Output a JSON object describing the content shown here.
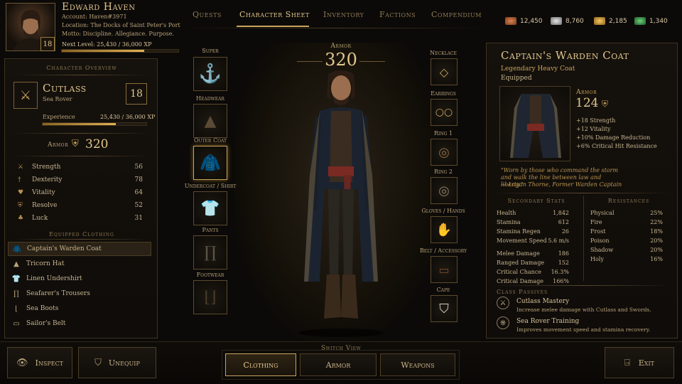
{
  "player": {
    "name": "Edward Haven",
    "account": "Account: Haven#3971",
    "location": "Location: The Docks of Saint Peter's Port",
    "motto": "Motto: Discipline. Allegiance. Purpose.",
    "level": "18",
    "next_level": "Next Level: 25,430 / 36,000 XP",
    "xp_fraction": 0.706
  },
  "tabs": [
    {
      "label": "Quests",
      "active": false
    },
    {
      "label": "Character Sheet",
      "active": true
    },
    {
      "label": "Inventory",
      "active": false
    },
    {
      "label": "Factions",
      "active": false
    },
    {
      "label": "Compendium",
      "active": false
    }
  ],
  "currencies": [
    {
      "icon": "copper-coins-icon",
      "value": "12,450",
      "color": "#b5603a"
    },
    {
      "icon": "silver-coins-icon",
      "value": "8,760",
      "color": "#b9b9b9"
    },
    {
      "icon": "gold-coins-icon",
      "value": "2,185",
      "color": "#d9a13a"
    },
    {
      "icon": "gem-icon",
      "value": "1,340",
      "color": "#3f9a4a"
    }
  ],
  "overview": {
    "title": "Character Overview",
    "class_name": "Cutlass",
    "subclass": "Sea Rover",
    "level": "18",
    "experience_label": "Experience",
    "experience_value": "25,430 / 36,000 XP",
    "armor_label": "Armor",
    "armor_value": "320",
    "stats": [
      {
        "name": "Strength",
        "value": "56",
        "icon": "sword-icon"
      },
      {
        "name": "Dexterity",
        "value": "78",
        "icon": "dagger-icon"
      },
      {
        "name": "Vitality",
        "value": "64",
        "icon": "heart-icon"
      },
      {
        "name": "Resolve",
        "value": "52",
        "icon": "shield-icon"
      },
      {
        "name": "Luck",
        "value": "31",
        "icon": "clover-icon"
      }
    ],
    "equipped_title": "Equipped Clothing",
    "equipped": [
      {
        "name": "Captain's Warden Coat",
        "icon": "coat-icon",
        "selected": true
      },
      {
        "name": "Tricorn Hat",
        "icon": "hat-icon",
        "selected": false
      },
      {
        "name": "Linen Undershirt",
        "icon": "shirt-icon",
        "selected": false
      },
      {
        "name": "Seafarer's Trousers",
        "icon": "trousers-icon",
        "selected": false
      },
      {
        "name": "Sea Boots",
        "icon": "boots-icon",
        "selected": false
      },
      {
        "name": "Sailor's Belt",
        "icon": "belt-icon",
        "selected": false
      }
    ]
  },
  "center": {
    "armor_label": "Armor",
    "armor_value": "320",
    "left_slots": [
      {
        "label": "Super",
        "icon": "anchor-icon",
        "selected": false
      },
      {
        "label": "Headwear",
        "icon": "tricorn-hat-icon",
        "selected": false
      },
      {
        "label": "Outer Coat",
        "icon": "coat-icon",
        "selected": true
      },
      {
        "label": "Undercoat / Shirt",
        "icon": "shirt-icon",
        "selected": false
      },
      {
        "label": "Pants",
        "icon": "trousers-icon",
        "selected": false
      },
      {
        "label": "Footwear",
        "icon": "boots-icon",
        "selected": false
      }
    ],
    "right_slots": [
      {
        "label": "Necklace",
        "icon": "necklace-icon"
      },
      {
        "label": "Earrings",
        "icon": "earrings-icon"
      },
      {
        "label": "Ring 1",
        "icon": "ring-icon"
      },
      {
        "label": "Ring 2",
        "icon": "ring-icon"
      },
      {
        "label": "Gloves / Hands",
        "icon": "glove-icon"
      },
      {
        "label": "Belt / Accessory",
        "icon": "belt-icon"
      },
      {
        "label": "Cape",
        "icon": "cape-icon"
      }
    ]
  },
  "item": {
    "name": "Captain's Warden Coat",
    "rarity": "Legendary Heavy Coat",
    "status": "Equipped",
    "armor_label": "Armor",
    "armor_value": "124",
    "bonuses": [
      "+18 Strength",
      "+12 Vitality",
      "+10% Damage Reduction",
      "+6% Critical Hit Resistance"
    ],
    "quote": "\"Worn by those who command the storm and walk the line between law and liberty.\"",
    "quote_author": "— Logan Thorne, Former Warden Captain"
  },
  "secondary": {
    "title": "Secondary Stats",
    "group1": [
      {
        "name": "Health",
        "value": "1,842"
      },
      {
        "name": "Stamina",
        "value": "612"
      },
      {
        "name": "Stamina Regen",
        "value": "26"
      },
      {
        "name": "Movement Speed",
        "value": "5.6 m/s"
      }
    ],
    "group2": [
      {
        "name": "Melee Damage",
        "value": "186"
      },
      {
        "name": "Ranged Damage",
        "value": "152"
      },
      {
        "name": "Critical Chance",
        "value": "16.3%"
      },
      {
        "name": "Critical Damage",
        "value": "166%"
      }
    ]
  },
  "resistances": {
    "title": "Resistances",
    "items": [
      {
        "name": "Physical",
        "value": "25%"
      },
      {
        "name": "Fire",
        "value": "22%"
      },
      {
        "name": "Frost",
        "value": "18%"
      },
      {
        "name": "Poison",
        "value": "20%"
      },
      {
        "name": "Shadow",
        "value": "20%"
      },
      {
        "name": "Holy",
        "value": "16%"
      }
    ]
  },
  "passives": {
    "title": "Class Passives",
    "items": [
      {
        "name": "Cutlass Mastery",
        "desc": "Increase melee damage with Cutlass and Swords."
      },
      {
        "name": "Sea Rover Training",
        "desc": "Improves movement speed and stamina recovery."
      }
    ]
  },
  "footer": {
    "inspect": "Inspect",
    "unequip": "Unequip",
    "switch_view": "Switch View",
    "views": [
      {
        "label": "Clothing",
        "active": true
      },
      {
        "label": "Armor",
        "active": false
      },
      {
        "label": "Weapons",
        "active": false
      }
    ],
    "exit": "Exit"
  }
}
